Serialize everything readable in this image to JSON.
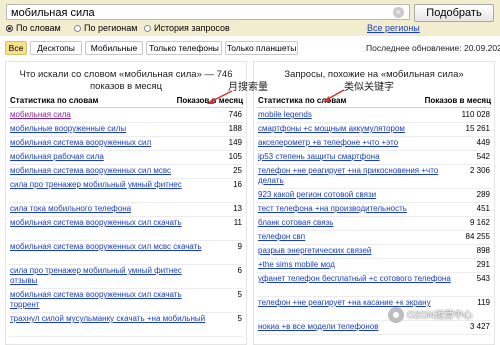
{
  "search": {
    "value": "мобильная сила",
    "button_label": "Подобрать",
    "clear_symbol": "×"
  },
  "modes": [
    {
      "label": "По словам",
      "selected": true
    },
    {
      "label": "По регионам",
      "selected": false
    },
    {
      "label": "История запросов",
      "selected": false
    }
  ],
  "regions_link": "Все регионы",
  "tabs": [
    {
      "label": "Все",
      "active": true
    },
    {
      "label": "Десктопы",
      "active": false
    },
    {
      "label": "Мобильные",
      "active": false
    },
    {
      "label": "Только телефоны",
      "active": false
    },
    {
      "label": "Только планшеты",
      "active": false
    }
  ],
  "last_updated": "Последнее обновление: 20.09.2021",
  "left_panel": {
    "title_line1": "Что искали со словом «мобильная сила» — 746",
    "title_line2": "показов в месяц",
    "col_query": "Статистика по словам",
    "col_count": "Показов в месяц",
    "rows": [
      {
        "q": "мобильная сила",
        "n": "746",
        "visited": true
      },
      {
        "q": "мобильные вооруженные силы",
        "n": "188"
      },
      {
        "q": "мобильная система вооруженных сил",
        "n": "149"
      },
      {
        "q": "мобильная рабочая сила",
        "n": "105"
      },
      {
        "q": "мобильная система вооруженных сил мсвс",
        "n": "25"
      },
      {
        "q": "сила про тренажер мобильный умный фитнес",
        "n": "16"
      },
      {
        "q": "сила тока мобильного телефона",
        "n": "13"
      },
      {
        "q": "мобильная система вооруженных сил скачать",
        "n": "11"
      },
      {
        "q": "мобильная система вооруженных сил мсвс скачать",
        "n": "9"
      },
      {
        "q": "сила про тренажер мобильный умный фитнес отзывы",
        "n": "6"
      },
      {
        "q": "мобильная система вооруженных сил скачать торрент",
        "n": "5"
      },
      {
        "q": "трахнул силой мусульманку скачать +на мобильный",
        "n": "5"
      }
    ]
  },
  "right_panel": {
    "title": "Запросы, похожие на «мобильная сила»",
    "col_query": "Статистика по словам",
    "col_count": "Показов в месяц",
    "rows": [
      {
        "q": "mobile legends",
        "n": "110 028"
      },
      {
        "q": "смартфоны +с мощным аккумулятором",
        "n": "15 261"
      },
      {
        "q": "акселерометр +в телефоне +что +это",
        "n": "449"
      },
      {
        "q": "ip53 степень защиты смартфона",
        "n": "542"
      },
      {
        "q": "телефон +не реагирует +на прикосновения +что делать",
        "n": "2 306"
      },
      {
        "q": "923 какой регион сотовой связи",
        "n": "289"
      },
      {
        "q": "тест телефона +на производительность",
        "n": "451"
      },
      {
        "q": "бланк сотовая связь",
        "n": "9 162"
      },
      {
        "q": "телефон свп",
        "n": "84 255"
      },
      {
        "q": "разрыв энергетических связей",
        "n": "898"
      },
      {
        "q": "+the sims mobile мод",
        "n": "291"
      },
      {
        "q": "уфанет телефон бесплатный +с сотового телефона",
        "n": "543"
      },
      {
        "q": "телефон +не реагирует +на касание +к экрану",
        "n": "119"
      },
      {
        "q": "нокиа +в все модели телефонов",
        "n": "3 427"
      }
    ]
  },
  "annotations": {
    "left": "月搜索量",
    "right": "类似关键字"
  },
  "watermark": "OZON运营中心"
}
